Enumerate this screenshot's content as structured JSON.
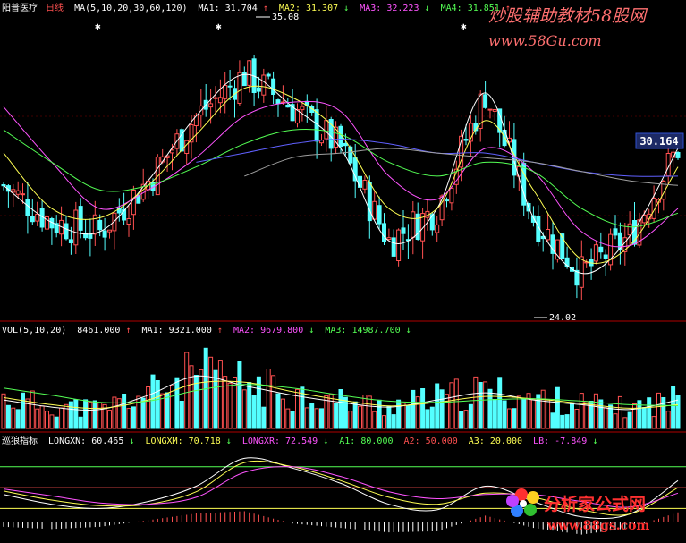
{
  "stock": {
    "name": "阳普医疗",
    "period": "日线"
  },
  "colors": {
    "bg": "#000000",
    "up": "#ff5050",
    "down": "#54ffff",
    "white": "#ffffff",
    "yellow": "#ffff54",
    "magenta": "#ff54ff",
    "green": "#54ff54",
    "blue": "#6060ff",
    "gray": "#a0a0a0",
    "divider": "#b00000"
  },
  "watermark_top": {
    "line1": "炒股辅助教材58股网",
    "line2": "www.58Gu.com"
  },
  "watermark_bottom": {
    "line1": "分析家公式网",
    "line2": "www.88gs.com"
  },
  "chart_data": [
    {
      "type": "candlestick",
      "legend": {
        "label": "MA(5,10,20,30,60,120)",
        "items": [
          {
            "name": "MA1",
            "value": "31.704",
            "arrow": "↑"
          },
          {
            "name": "MA2",
            "value": "31.307",
            "arrow": "↓"
          },
          {
            "name": "MA3",
            "value": "32.223",
            "arrow": "↓"
          },
          {
            "name": "MA4",
            "value": "31.851",
            "arrow": "↑"
          }
        ]
      },
      "annotations": {
        "high": "35.08",
        "low": "24.02"
      },
      "last_price": "30.164",
      "ylim": [
        23.0,
        36.0
      ],
      "series": [
        {
          "name": "MA1",
          "color": "#ffffff",
          "x": [
            0,
            10,
            20,
            30,
            40,
            50,
            60,
            70,
            80,
            90,
            100,
            110,
            120,
            130,
            140
          ],
          "values": [
            28.6,
            27.0,
            26.6,
            28.8,
            31.6,
            33.4,
            32.0,
            30.2,
            26.2,
            27.6,
            32.6,
            27.2,
            24.8,
            26.4,
            30.2
          ]
        },
        {
          "name": "MA2",
          "color": "#ffff54",
          "x": [
            0,
            10,
            20,
            30,
            40,
            50,
            60,
            70,
            80,
            90,
            100,
            110,
            120,
            130,
            140
          ],
          "values": [
            30.0,
            27.6,
            27.2,
            28.6,
            30.8,
            32.8,
            32.4,
            30.8,
            27.6,
            27.6,
            31.4,
            28.4,
            25.4,
            26.0,
            29.4
          ]
        },
        {
          "name": "MA3",
          "color": "#ff54ff",
          "x": [
            0,
            10,
            20,
            30,
            40,
            50,
            60,
            70,
            80,
            90,
            100,
            110,
            120,
            130,
            140
          ],
          "values": [
            32.0,
            29.6,
            27.6,
            28.4,
            29.8,
            31.6,
            32.2,
            31.8,
            29.0,
            28.0,
            30.2,
            29.2,
            26.6,
            26.0,
            27.6
          ]
        },
        {
          "name": "MA4",
          "color": "#54ff54",
          "x": [
            0,
            10,
            20,
            30,
            40,
            50,
            60,
            70,
            80,
            90,
            100,
            110,
            120,
            130,
            140
          ],
          "values": [
            31.0,
            29.6,
            28.4,
            28.6,
            29.4,
            30.4,
            31.0,
            30.8,
            29.6,
            29.0,
            29.6,
            29.2,
            27.6,
            26.8,
            27.4
          ]
        },
        {
          "name": "MA5",
          "color": "#6060ff",
          "x": [
            40,
            50,
            60,
            70,
            80,
            90,
            100,
            110,
            120,
            130,
            140
          ],
          "values": [
            29.6,
            30.0,
            30.4,
            30.6,
            30.4,
            30.0,
            30.0,
            29.6,
            29.2,
            29.0,
            29.0
          ]
        },
        {
          "name": "MA6",
          "color": "#a0a0a0",
          "x": [
            50,
            60,
            70,
            80,
            90,
            100,
            110,
            120,
            130,
            140
          ],
          "values": [
            29.0,
            29.8,
            30.0,
            30.2,
            30.0,
            29.8,
            29.6,
            29.2,
            28.8,
            28.6
          ]
        }
      ]
    },
    {
      "type": "bar",
      "legend": {
        "label": "VOL(5,10,20)",
        "value": "8461.000",
        "value_arrow": "↑",
        "items": [
          {
            "name": "MA1",
            "value": "9321.000",
            "arrow": "↑"
          },
          {
            "name": "MA2",
            "value": "9679.800",
            "arrow": "↓"
          },
          {
            "name": "MA3",
            "value": "14987.700",
            "arrow": "↓"
          }
        ]
      },
      "ylim": [
        0,
        38000
      ],
      "series": [
        {
          "name": "MA1",
          "color": "#ffffff",
          "x": [
            0,
            10,
            20,
            30,
            40,
            50,
            60,
            70,
            80,
            90,
            100,
            110,
            120,
            130,
            140
          ],
          "values": [
            12000,
            9000,
            8000,
            14000,
            22000,
            18000,
            14000,
            11000,
            9000,
            12000,
            15000,
            12000,
            10000,
            8000,
            12000
          ]
        },
        {
          "name": "MA2",
          "color": "#ffff54",
          "x": [
            0,
            10,
            20,
            30,
            40,
            50,
            60,
            70,
            80,
            90,
            100,
            110,
            120,
            130,
            140
          ],
          "values": [
            13000,
            10000,
            8500,
            12000,
            19000,
            19500,
            15500,
            12000,
            9500,
            11000,
            13500,
            12500,
            10500,
            8500,
            10000
          ]
        },
        {
          "name": "MA3",
          "color": "#54ff54",
          "x": [
            0,
            10,
            20,
            30,
            40,
            50,
            60,
            70,
            80,
            90,
            100,
            110,
            120,
            130,
            140
          ],
          "values": [
            17000,
            14000,
            11000,
            11500,
            16000,
            18500,
            17000,
            14000,
            11500,
            11000,
            12000,
            12500,
            11500,
            10000,
            9600
          ]
        }
      ]
    },
    {
      "type": "line",
      "legend": {
        "label": "巡狼指标",
        "items": [
          {
            "name": "LONGXN",
            "value": "60.465",
            "arrow": "↓"
          },
          {
            "name": "LONGXM",
            "value": "70.718",
            "arrow": "↓"
          },
          {
            "name": "LONGXR",
            "value": "72.549",
            "arrow": "↓"
          },
          {
            "name": "A1",
            "value": "80.000"
          },
          {
            "name": "A2",
            "value": "50.000"
          },
          {
            "name": "A3",
            "value": "20.000"
          },
          {
            "name": "LB",
            "value": "-7.849",
            "arrow": "↓"
          }
        ]
      },
      "ylim": [
        -22,
        108
      ],
      "series": [
        {
          "name": "LONGXN",
          "color": "#ffffff",
          "x": [
            0,
            10,
            20,
            30,
            40,
            50,
            60,
            70,
            80,
            90,
            100,
            110,
            120,
            130,
            140
          ],
          "values": [
            40,
            26,
            20,
            30,
            52,
            92,
            78,
            56,
            26,
            18,
            52,
            30,
            8,
            12,
            60
          ]
        },
        {
          "name": "LONGXM",
          "color": "#ffff54",
          "x": [
            0,
            10,
            20,
            30,
            40,
            50,
            60,
            70,
            80,
            90,
            100,
            110,
            120,
            130,
            140
          ],
          "values": [
            45,
            32,
            24,
            26,
            44,
            86,
            80,
            60,
            36,
            26,
            42,
            36,
            18,
            12,
            50
          ]
        },
        {
          "name": "LONGXR",
          "color": "#ff54ff",
          "x": [
            0,
            10,
            20,
            30,
            40,
            50,
            60,
            70,
            80,
            90,
            100,
            110,
            120,
            130,
            140
          ],
          "values": [
            48,
            38,
            28,
            26,
            36,
            72,
            80,
            66,
            44,
            34,
            40,
            40,
            30,
            22,
            42
          ]
        }
      ],
      "levels": [
        {
          "name": "A1",
          "value": 80,
          "color": "#54ff54"
        },
        {
          "name": "A2",
          "value": 50,
          "color": "#ff5050"
        },
        {
          "name": "A3",
          "value": 20,
          "color": "#ffff54"
        }
      ]
    }
  ]
}
